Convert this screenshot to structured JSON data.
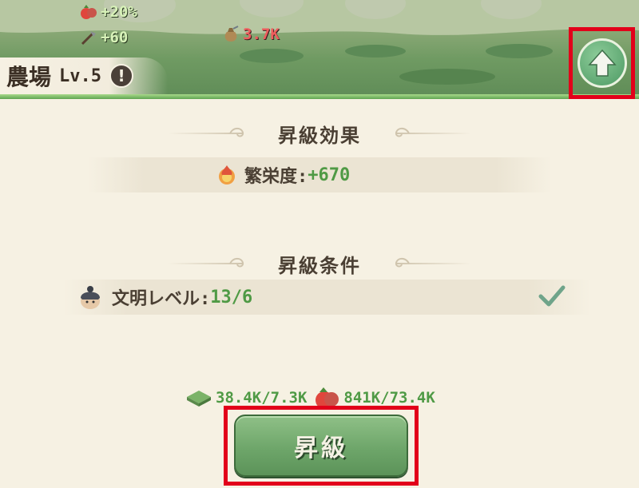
{
  "banner": {
    "bonus_1": "+20%",
    "bonus_2": "+60",
    "income": "3.7K",
    "farm_name": "農場",
    "level": "Lv.5",
    "info_symbol": "!"
  },
  "effects": {
    "title": "昇級効果",
    "prosperity_label": "繁栄度:",
    "prosperity_value": "+670"
  },
  "conditions": {
    "title": "昇級条件",
    "civ_label": "文明レベル:",
    "civ_value": "13/6",
    "met": true
  },
  "cost": {
    "material": "38.4K/7.3K",
    "food": "841K/73.4K"
  },
  "actions": {
    "upgrade_label": "昇級"
  },
  "colors": {
    "accent_green": "#4f9a45",
    "highlight_red": "#e2001a",
    "button_green": "#6ea66a"
  }
}
